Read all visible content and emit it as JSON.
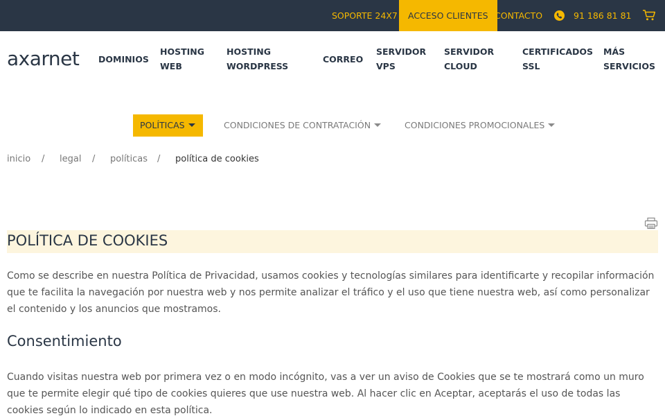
{
  "topbar": {
    "support": "SOPORTE 24X7",
    "clients": "ACCESO CLIENTES",
    "contact": "CONTACTO",
    "phone": "91 186 81 81"
  },
  "logo": "axarnet",
  "nav": [
    {
      "line1": "DOMINIOS",
      "line2": ""
    },
    {
      "line1": "HOSTING",
      "line2": "WEB"
    },
    {
      "line1": "HOSTING",
      "line2": "WORDPRESS"
    },
    {
      "line1": "CORREO",
      "line2": ""
    },
    {
      "line1": "SERVIDOR",
      "line2": "VPS"
    },
    {
      "line1": "SERVIDOR",
      "line2": "CLOUD"
    },
    {
      "line1": "CERTIFICADOS",
      "line2": "SSL"
    },
    {
      "line1": "MÁS",
      "line2": "SERVICIOS"
    }
  ],
  "subnav": {
    "policies": "POLÍTICAS",
    "contracting": "CONDICIONES DE CONTRATACIÓN",
    "promotional": "CONDICIONES PROMOCIONALES"
  },
  "breadcrumb": {
    "home": "inicio",
    "sep": "/",
    "legal": "legal",
    "policies": "políticas",
    "current": "política de cookies"
  },
  "content": {
    "title": "POLÍTICA DE COOKIES",
    "intro": "Como se describe en nuestra Política de Privacidad, usamos cookies y tecnologías similares para identificarte y recopilar información que te facilita la navegación por nuestra web y nos permite analizar el tráfico y el uso que tiene nuestra web, así como personalizar el contenido y los anuncios que mostramos.",
    "consent_heading": "Consentimiento",
    "consent_text": "Cuando visitas nuestra web por primera vez o en modo incógnito, vas a ver un aviso de Cookies que se te mostrará como un muro que te permite elegir qué tipo de cookies quieres que use nuestra web. Al hacer clic en Aceptar, aceptarás el uso de todas las cookies según lo indicado en esta política."
  },
  "colors": {
    "dark": "#2a3645",
    "accent": "#f5b800",
    "title_bg": "#fdf5de"
  },
  "icons": {
    "phone": "phone-icon",
    "cart": "cart-icon",
    "print": "print-icon"
  }
}
